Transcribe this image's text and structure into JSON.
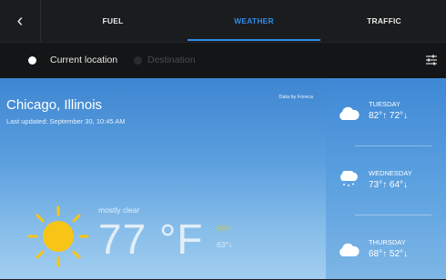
{
  "tabs": {
    "back": "‹",
    "fuel": "FUEL",
    "weather": "WEATHER",
    "traffic": "TRAFFIC"
  },
  "location": {
    "current": "Current location",
    "destination": "Destination"
  },
  "weather": {
    "city": "Chicago, Illinois",
    "updated": "Last updated: September 30, 10:45 AM",
    "credit": "Data by Foreca",
    "condition": "mostly clear",
    "temp": "77 °F",
    "high": "85°↑",
    "low": "63°↓"
  },
  "forecast": [
    {
      "day": "TUESDAY",
      "temps": "82°↑ 72°↓"
    },
    {
      "day": "WEDNESDAY",
      "temps": "73°↑ 64°↓"
    },
    {
      "day": "THURSDAY",
      "temps": "68°↑ 52°↓"
    }
  ],
  "colors": {
    "accent": "#2f8be9",
    "high_temp": "#d6c63a",
    "sun": "#f8c516"
  }
}
